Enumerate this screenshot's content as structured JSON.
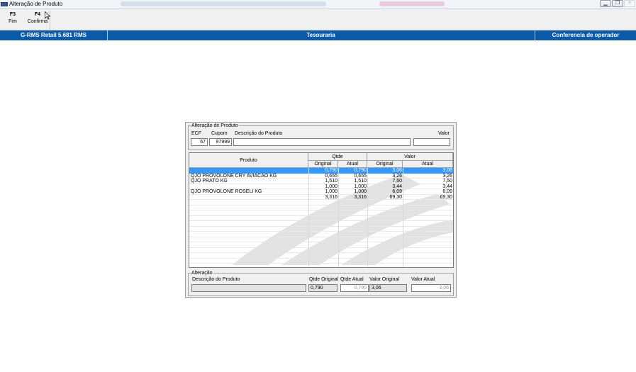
{
  "window": {
    "title": "Alteração de Produto",
    "controls": [
      "minimize-icon",
      "restore-icon",
      "close-icon"
    ]
  },
  "toolbar": {
    "items": [
      {
        "key": "F3",
        "label": "Fim"
      },
      {
        "key": "F4",
        "label": "Confirma"
      }
    ]
  },
  "statusbar": {
    "system": "G-RMS Retail 5.681 RMS",
    "module": "Tesouraria",
    "screen": "Conferencia de operador"
  },
  "dialog": {
    "legend": "Alteração de Produto",
    "labels": {
      "ecf": "ECF",
      "cupom": "Cupom",
      "descricao": "Descrição do Produto",
      "valor": "Valor"
    },
    "values": {
      "ecf": "67",
      "cupom": "97999",
      "descricao": "",
      "valor": ""
    },
    "grid": {
      "headers": {
        "produto": "Produto",
        "qtde": "Qtde",
        "valor": "Valor",
        "original": "Original",
        "atual": "Atual"
      },
      "rows": [
        {
          "produto": "",
          "qtde_original": "0,790",
          "qtde_atual": "0,790",
          "valor_original": "3,06",
          "valor_atual": "3,06",
          "selected": true
        },
        {
          "produto": "QJO PROVOLONE CRY AVIACAO KG",
          "qtde_original": "0,655",
          "qtde_atual": "0,655",
          "valor_original": "3,26",
          "valor_atual": "3,26",
          "selected": false
        },
        {
          "produto": "QJO PRATO KG",
          "qtde_original": "1,510",
          "qtde_atual": "1,510",
          "valor_original": "7,50",
          "valor_atual": "7,50",
          "selected": false
        },
        {
          "produto": "",
          "qtde_original": "1,000",
          "qtde_atual": "1,000",
          "valor_original": "3,44",
          "valor_atual": "3,44",
          "selected": false
        },
        {
          "produto": "QJO PROVOLONE ROSELI KG",
          "qtde_original": "1,000",
          "qtde_atual": "1,000",
          "valor_original": "6,09",
          "valor_atual": "6,09",
          "selected": false
        },
        {
          "produto": "",
          "qtde_original": "3,316",
          "qtde_atual": "3,316",
          "valor_original": "69,30",
          "valor_atual": "69,30",
          "selected": false
        }
      ]
    },
    "alteracao": {
      "legend": "Alteração",
      "labels": {
        "descricao": "Descrição do Produto",
        "qtde_original": "Qtde Original",
        "qtde_atual": "Qtde Atual",
        "valor_original": "Valor Original",
        "valor_atual": "Valor Atual"
      },
      "values": {
        "descricao": "",
        "qtde_original": "0,790",
        "qtde_atual": "0,790",
        "valor_original": "3,06",
        "valor_atual": "3,06"
      }
    }
  }
}
